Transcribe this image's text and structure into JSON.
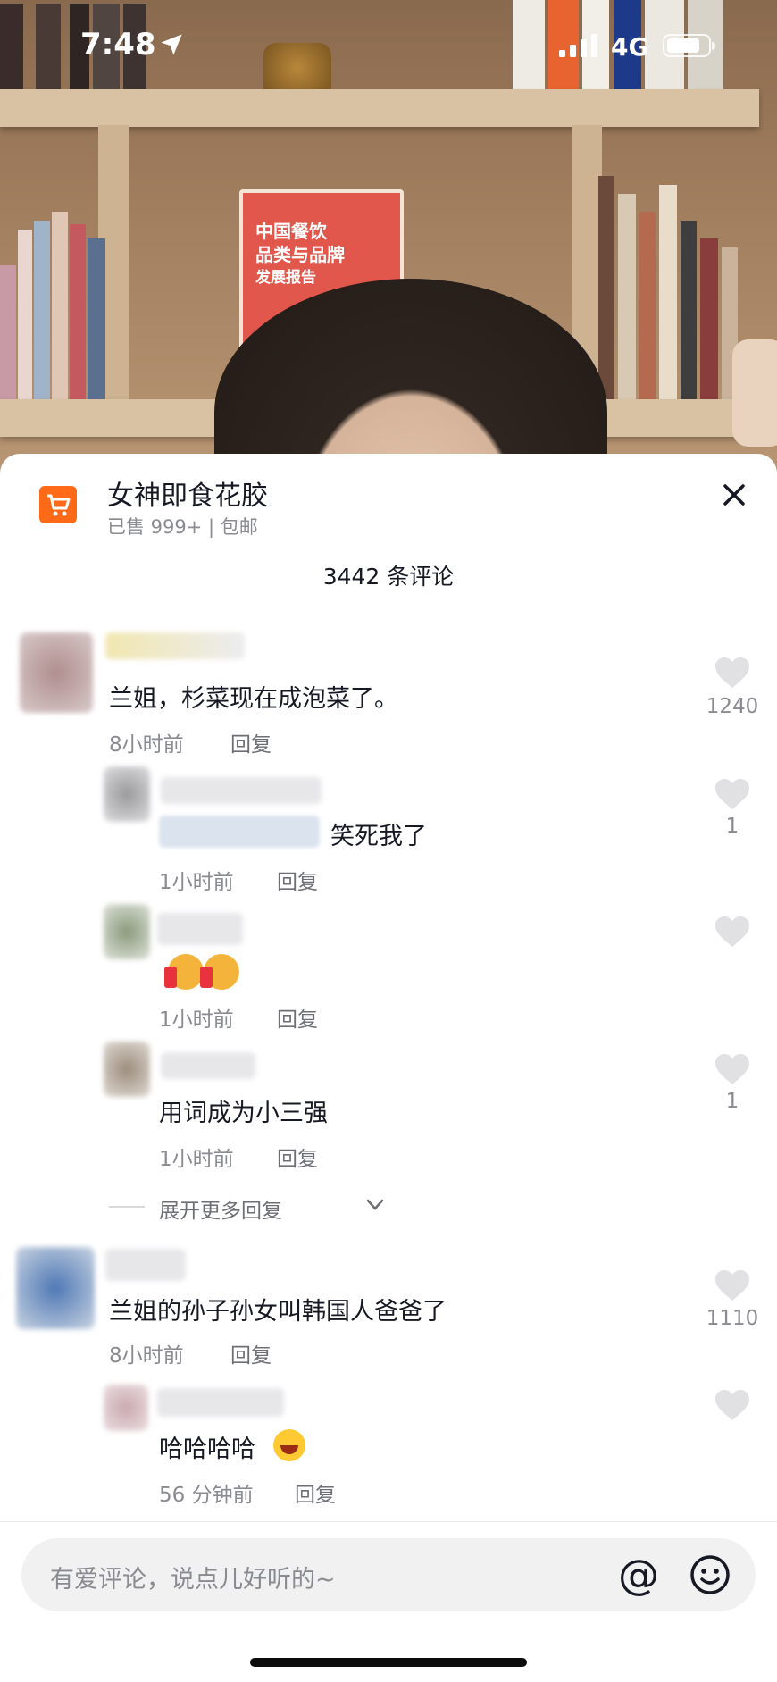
{
  "status_bar": {
    "time": "7:48",
    "network": "4G"
  },
  "video": {
    "book_cover_text": [
      "中国餐饮",
      "品类与品牌",
      "发展报告"
    ]
  },
  "product": {
    "title": "女神即食花胶",
    "subtitle": "已售 999+ | 包邮"
  },
  "comments_count": "3442 条评论",
  "reply_label": "回复",
  "expand_more": "展开更多回复",
  "comments": [
    {
      "text": "兰姐，杉菜现在成泡菜了。",
      "time": "8小时前",
      "likes": "1240"
    },
    {
      "text": "笑死我了",
      "time": "1小时前",
      "likes": "1"
    },
    {
      "text": "",
      "time": "1小时前",
      "likes": ""
    },
    {
      "text": "用词成为小三强",
      "time": "1小时前",
      "likes": "1"
    },
    {
      "text": "兰姐的孙子孙女叫韩国人爸爸了",
      "time": "8小时前",
      "likes": "1110"
    },
    {
      "text": "哈哈哈哈",
      "time": "56 分钟前",
      "likes": ""
    }
  ],
  "input": {
    "placeholder": "有爱评论，说点儿好听的~",
    "at_symbol": "@"
  },
  "colors": {
    "accent": "#fe6a18",
    "muted": "#8a8b91",
    "heart": "#e1e1e3"
  },
  "icons": [
    "location-arrow-icon",
    "signal-icon",
    "battery-icon",
    "cart-icon",
    "close-icon",
    "heart-icon",
    "chevron-down-icon",
    "at-icon",
    "emoji-icon"
  ]
}
